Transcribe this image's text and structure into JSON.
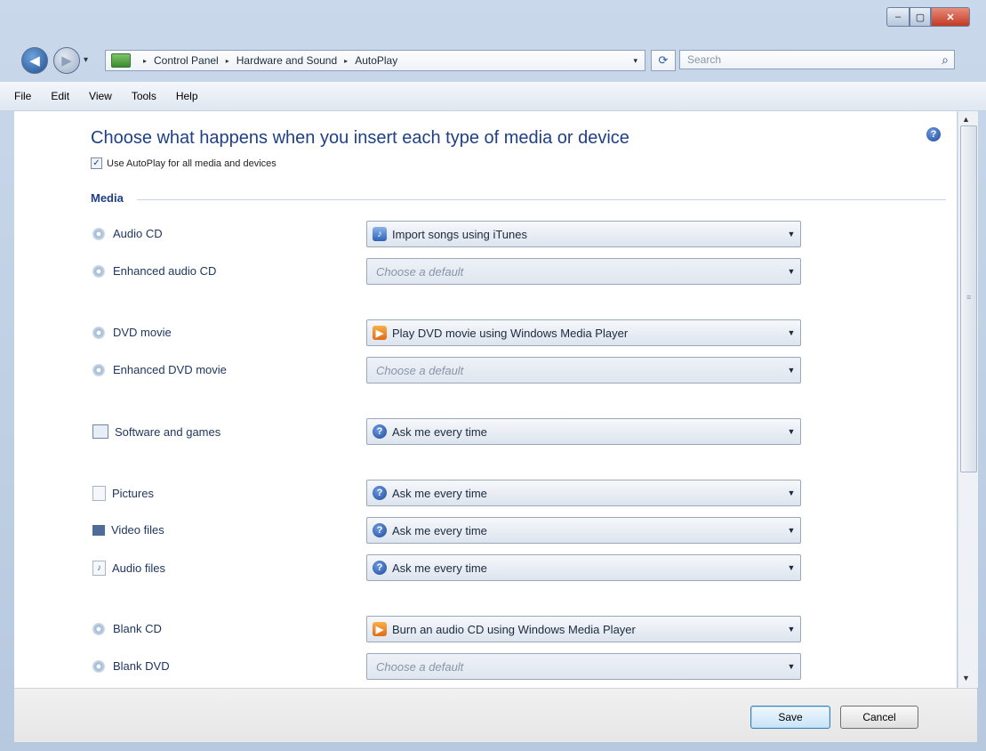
{
  "window": {
    "controls": {
      "minimize": "–",
      "maximize": "▢",
      "close": "✕"
    }
  },
  "nav": {
    "back_icon": "◀",
    "forward_icon": "▶",
    "history_icon": "▾",
    "breadcrumb": [
      "Control Panel",
      "Hardware and Sound",
      "AutoPlay"
    ],
    "breadcrumb_sep": "▸",
    "dropdown_icon": "▾",
    "refresh_icon": "⟳",
    "search_placeholder": "Search",
    "search_icon": "⌕"
  },
  "menu": [
    "File",
    "Edit",
    "View",
    "Tools",
    "Help"
  ],
  "header": {
    "title": "Choose what happens when you insert each type of media or device",
    "help_icon": "?",
    "autoplay_checkbox_label": "Use AutoPlay for all media and devices",
    "autoplay_checked": true,
    "check_glyph": "✓"
  },
  "section": {
    "title": "Media"
  },
  "rows": [
    {
      "label": "Audio CD",
      "icon": "cd-icon",
      "value": "Import songs using iTunes",
      "value_icon": "itunes-icon"
    },
    {
      "label": "Enhanced audio CD",
      "icon": "cd-icon",
      "value": "Choose a default",
      "value_icon": ""
    },
    {
      "label": "DVD movie",
      "icon": "dvd-icon",
      "value": "Play DVD movie using Windows Media Player",
      "value_icon": "wmp-icon"
    },
    {
      "label": "Enhanced DVD movie",
      "icon": "dvd-icon",
      "value": "Choose a default",
      "value_icon": ""
    },
    {
      "label": "Software and games",
      "icon": "software-icon",
      "value": "Ask me every time",
      "value_icon": "ask-icon"
    },
    {
      "label": "Pictures",
      "icon": "pictures-icon",
      "value": "Ask me every time",
      "value_icon": "ask-icon"
    },
    {
      "label": "Video files",
      "icon": "video-icon",
      "value": "Ask me every time",
      "value_icon": "ask-icon"
    },
    {
      "label": "Audio files",
      "icon": "audio-file-icon",
      "value": "Ask me every time",
      "value_icon": "ask-icon"
    },
    {
      "label": "Blank CD",
      "icon": "blank-cd-icon",
      "value": "Burn an audio CD using Windows Media Player",
      "value_icon": "wmp-icon"
    },
    {
      "label": "Blank DVD",
      "icon": "blank-dvd-icon",
      "value": "Choose a default",
      "value_icon": ""
    }
  ],
  "glyphs": {
    "dropdown_arrow": "▼",
    "play": "▶",
    "ask": "?",
    "note": "♪",
    "scroll_up": "▲",
    "scroll_down": "▼",
    "grip": "≡"
  },
  "footer": {
    "save": "Save",
    "cancel": "Cancel"
  },
  "colors": {
    "title": "#1f3f87",
    "accent": "#3c7fb1"
  }
}
